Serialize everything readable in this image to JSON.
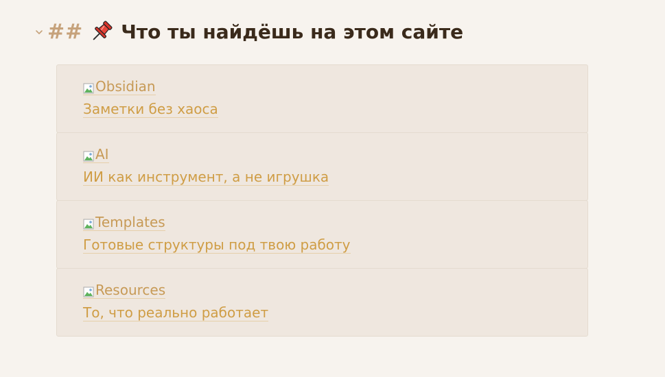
{
  "heading": {
    "hashes": "##",
    "emoji": "📌",
    "emoji_icon": "pushpin-icon",
    "title": "Что ты найдёшь на этом сайте",
    "collapse_icon": "chevron-down-icon"
  },
  "colors": {
    "background": "#f7f3ee",
    "card_background": "#efe7df",
    "link": "#cf9d45",
    "hash": "#c6a27b",
    "title": "#3a2a1b"
  },
  "cards": [
    {
      "image_alt": "Obsidian",
      "description": "Заметки без хаоса"
    },
    {
      "image_alt": "AI",
      "description": "ИИ как инструмент, а не игрушка"
    },
    {
      "image_alt": "Templates",
      "description": "Готовые структуры под твою работу"
    },
    {
      "image_alt": "Resources",
      "description": "То, что реально работает"
    }
  ]
}
